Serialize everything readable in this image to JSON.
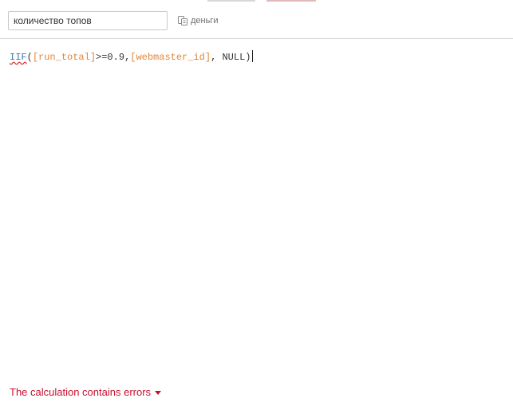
{
  "header": {
    "calc_name_value": "количество топов",
    "datasource_label": "деньги",
    "colors": {
      "border": "#c8c8c8",
      "divider": "#d4d4d4"
    }
  },
  "editor": {
    "tokens": [
      {
        "type": "function",
        "text": "IIF"
      },
      {
        "type": "plain",
        "text": "("
      },
      {
        "type": "field",
        "text": "[run_total]"
      },
      {
        "type": "plain",
        "text": ">=0.9,"
      },
      {
        "type": "field",
        "text": "[webmaster_id]"
      },
      {
        "type": "plain",
        "text": ", NULL)"
      }
    ],
    "colors": {
      "function": "#3f79b0",
      "field": "#e1853a",
      "plain": "#333333",
      "squiggle": "#d93030"
    }
  },
  "footer": {
    "error_label": "The calculation contains errors",
    "error_color": "#c8102e",
    "error_icon": "caret-down-icon"
  }
}
